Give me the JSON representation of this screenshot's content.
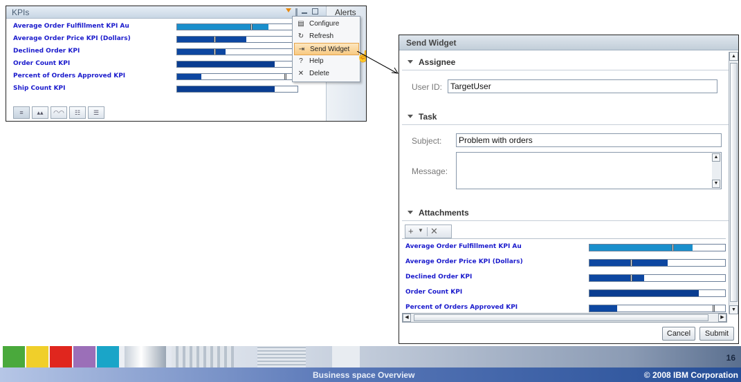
{
  "kpi_widget": {
    "title": "KPIs",
    "alerts_tab": "Alerts",
    "rows": [
      {
        "label": "Average Order Fulfillment KPI Au",
        "value": 0.75,
        "marker": 0.6,
        "color": "#1a8fcc"
      },
      {
        "label": "Average Order Price KPI (Dollars)",
        "value": 0.57,
        "marker": 0.3,
        "color": "#0d47a1"
      },
      {
        "label": "Declined Order KPI",
        "value": 0.4,
        "marker": 0.3,
        "color": "#0d47a1"
      },
      {
        "label": "Order Count KPI",
        "value": 0.8,
        "marker": null,
        "color": "#0a3d91"
      },
      {
        "label": "Percent of Orders Approved KPI",
        "value": 0.2,
        "marker": 0.88,
        "color": "#0d47a1"
      },
      {
        "label": "Ship Count KPI",
        "value": 0.8,
        "marker": null,
        "color": "#0a3d91"
      }
    ]
  },
  "context_menu": {
    "items": [
      {
        "label": "Configure",
        "icon": "configure-icon",
        "glyph": "▤"
      },
      {
        "label": "Refresh",
        "icon": "refresh-icon",
        "glyph": "↻"
      },
      {
        "label": "Send Widget",
        "icon": "send-widget-icon",
        "glyph": "⇥"
      },
      {
        "label": "Help",
        "icon": "help-icon",
        "glyph": "?"
      },
      {
        "label": "Delete",
        "icon": "delete-icon",
        "glyph": "✕"
      }
    ]
  },
  "dialog": {
    "title": "Send Widget",
    "assignee_section": "Assignee",
    "user_id_label": "User ID:",
    "user_id_value": "TargetUser",
    "task_section": "Task",
    "subject_label": "Subject:",
    "subject_value": "Problem with orders",
    "message_label": "Message:",
    "attachments_section": "Attachments",
    "attachments": [
      {
        "label": "Average Order Fulfillment KPI Au",
        "value": 0.75,
        "marker": 0.6,
        "color": "#1a8fcc"
      },
      {
        "label": "Average Order Price KPI (Dollars)",
        "value": 0.57,
        "marker": 0.3,
        "color": "#0d47a1"
      },
      {
        "label": "Declined Order KPI",
        "value": 0.4,
        "marker": 0.3,
        "color": "#0d47a1"
      },
      {
        "label": "Order Count KPI",
        "value": 0.8,
        "marker": null,
        "color": "#0a3d91"
      },
      {
        "label": "Percent of Orders Approved KPI",
        "value": 0.2,
        "marker": 0.9,
        "color": "#0d47a1"
      }
    ],
    "cancel_label": "Cancel",
    "submit_label": "Submit"
  },
  "footer": {
    "page_number": "16",
    "center_text": "Business space   Overview",
    "copyright": "© 2008 IBM Corporation",
    "tile_colors": [
      "#4aa93c",
      "#f0cf2a",
      "#e0261e",
      "#9b6fb8",
      "#1aa5c8"
    ]
  }
}
